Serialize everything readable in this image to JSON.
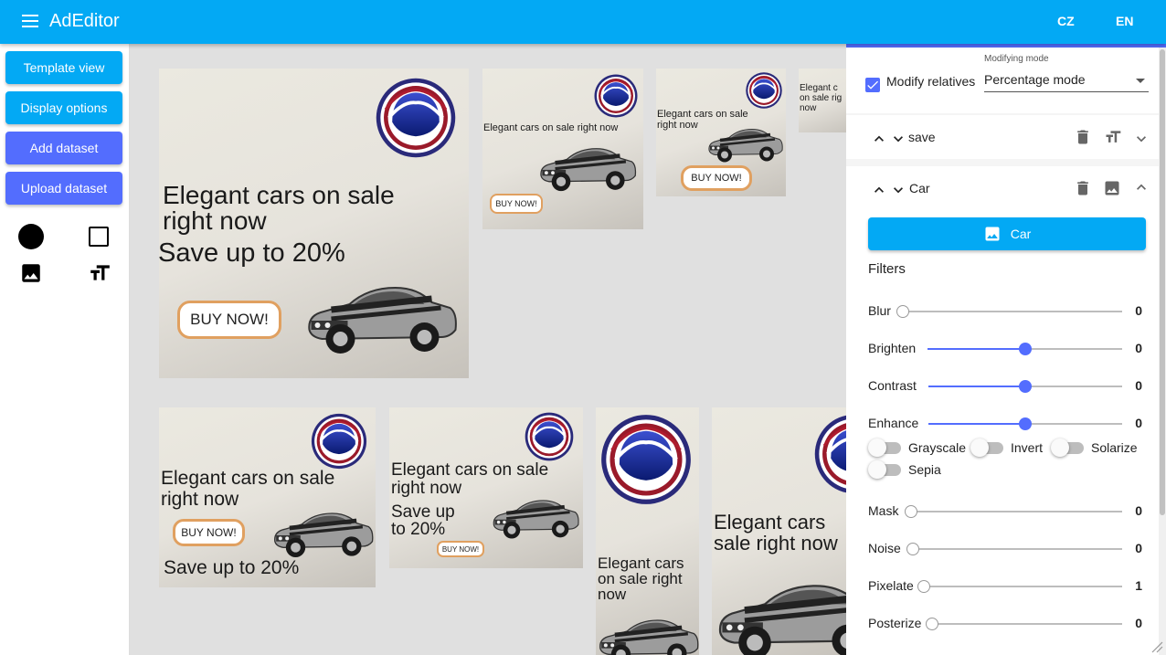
{
  "app": {
    "title": "AdEditor",
    "lang_cz": "CZ",
    "lang_en": "EN"
  },
  "colors": {
    "primary": "#03a9f4",
    "accent": "#536dfe",
    "buy_border": "#e0a060"
  },
  "sidebar": {
    "buttons": [
      {
        "label": "Template view"
      },
      {
        "label": "Display options"
      },
      {
        "label": "Add dataset"
      },
      {
        "label": "Upload dataset"
      }
    ],
    "tools": [
      "circle-shape-icon",
      "square-shape-icon",
      "image-icon",
      "text-size-icon"
    ]
  },
  "ads": {
    "headline": "Elegant cars on sale right now",
    "headline_l1": "Elegant cars on sale",
    "headline_l2": "right now",
    "save": "Save up to 20%",
    "save_l1": "Save up",
    "save_l2": "to 20%",
    "cta": "BUY NOW!",
    "narrow_l1": "Elegant cars",
    "narrow_l2": "on sale right",
    "narrow_l3": "now",
    "mid_l1": "Elegant cars on sale",
    "mid_l2": "right now",
    "tiny_l1": "Elegant c",
    "tiny_l2": "on sale rig",
    "tiny_l3": "now",
    "tall_l1": "Elegant cars",
    "tall_l2": "sale right now"
  },
  "panel": {
    "modify_relatives_label": "Modify relatives",
    "modify_relatives_checked": true,
    "modifying_mode_caption": "Modifying mode",
    "modifying_mode_value": "Percentage mode",
    "layers": [
      {
        "name": "save",
        "type": "text",
        "expanded": false
      },
      {
        "name": "Car",
        "type": "image",
        "expanded": true
      }
    ],
    "image_button_label": "Car",
    "filters_title": "Filters",
    "sliders": [
      {
        "name": "Blur",
        "value": "0",
        "position": 0.0
      },
      {
        "name": "Brighten",
        "value": "0",
        "position": 0.5
      },
      {
        "name": "Contrast",
        "value": "0",
        "position": 0.5
      },
      {
        "name": "Enhance",
        "value": "0",
        "position": 0.5
      }
    ],
    "toggles": [
      {
        "name": "Grayscale",
        "on": false
      },
      {
        "name": "Invert",
        "on": false
      },
      {
        "name": "Solarize",
        "on": false
      },
      {
        "name": "Sepia",
        "on": false
      }
    ],
    "sliders2": [
      {
        "name": "Mask",
        "value": "0",
        "position": 0.0
      },
      {
        "name": "Noise",
        "value": "0",
        "position": 0.0
      },
      {
        "name": "Pixelate",
        "value": "1",
        "position": 0.0
      },
      {
        "name": "Posterize",
        "value": "0",
        "position": 0.0
      }
    ]
  }
}
